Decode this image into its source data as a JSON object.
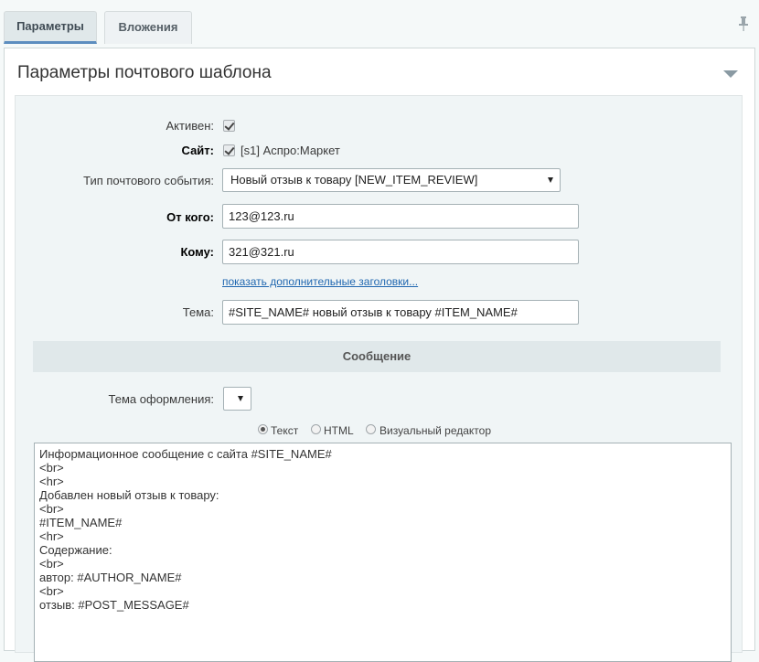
{
  "tabs": [
    {
      "label": "Параметры",
      "active": true
    },
    {
      "label": "Вложения",
      "active": false
    }
  ],
  "panel": {
    "title": "Параметры почтового шаблона"
  },
  "form": {
    "active_label": "Активен:",
    "active_checked": true,
    "site_label": "Сайт:",
    "site_checked": true,
    "site_value": "[s1] Аспро:Маркет",
    "event_type_label": "Тип почтового события:",
    "event_type_value": "Новый отзыв к товару [NEW_ITEM_REVIEW]",
    "from_label": "От кого:",
    "from_value": "123@123.ru",
    "to_label": "Кому:",
    "to_value": "321@321.ru",
    "extra_headers_link": "показать дополнительные заголовки...",
    "subject_label": "Тема:",
    "subject_value": "#SITE_NAME# новый отзыв к товару #ITEM_NAME#"
  },
  "message": {
    "section_title": "Сообщение",
    "theme_label": "Тема оформления:",
    "theme_value": "",
    "formats": [
      {
        "label": "Текст",
        "selected": true
      },
      {
        "label": "HTML",
        "selected": false
      },
      {
        "label": "Визуальный редактор",
        "selected": false
      }
    ],
    "body": "Информационное сообщение с сайта #SITE_NAME#\n<br>\n<hr>\nДобавлен новый отзыв к товару:\n<br>\n#ITEM_NAME#\n<hr>\nСодержание:\n<br>\nавтор: #AUTHOR_NAME#\n<br>\nотзыв: #POST_MESSAGE#"
  }
}
